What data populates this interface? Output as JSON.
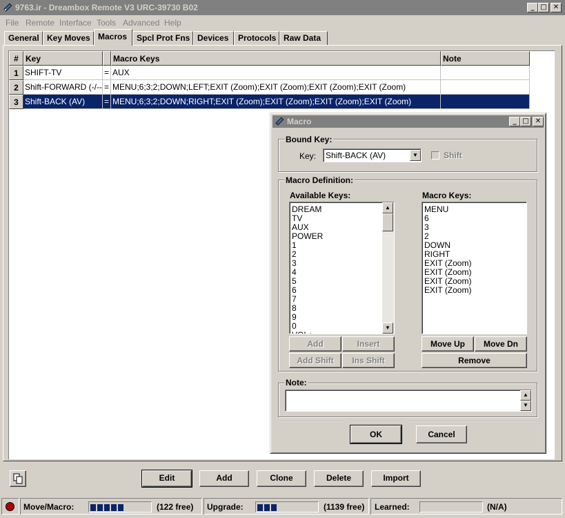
{
  "window": {
    "title": "9763.ir - Dreambox Remote V3 URC-39730 B02"
  },
  "menu": [
    "File",
    "Remote",
    "Interface",
    "Tools",
    "Advanced",
    "Help"
  ],
  "tabs": [
    "General",
    "Key Moves",
    "Macros",
    "Spcl Prot Fns",
    "Devices",
    "Protocols",
    "Raw Data"
  ],
  "active_tab": "Macros",
  "grid": {
    "headers": [
      "#",
      "Key",
      "",
      "Macro Keys",
      "Note"
    ],
    "rows": [
      {
        "num": "1",
        "key": "SHIFT-TV",
        "eq": "=",
        "macro": "AUX",
        "note": ""
      },
      {
        "num": "2",
        "key": "Shift-FORWARD (-/--)",
        "eq": "=",
        "macro": "MENU;6;3;2;DOWN;LEFT;EXIT (Zoom);EXIT (Zoom);EXIT (Zoom);EXIT (Zoom)",
        "note": ""
      },
      {
        "num": "3",
        "key": "Shift-BACK (AV)",
        "eq": "=",
        "macro": "MENU;6;3;2;DOWN;RIGHT;EXIT (Zoom);EXIT (Zoom);EXIT (Zoom);EXIT (Zoom)",
        "note": ""
      }
    ]
  },
  "dialog": {
    "title": "Macro",
    "bound_key_group": "Bound Key:",
    "key_label": "Key:",
    "key_value": "Shift-BACK (AV)",
    "shift_label": "Shift",
    "definition_group": "Macro Definition:",
    "available_label": "Available Keys:",
    "available_keys": [
      "DREAM",
      "TV",
      "AUX",
      "POWER",
      "1",
      "2",
      "3",
      "4",
      "5",
      "6",
      "7",
      "8",
      "9",
      "0",
      "VOL+"
    ],
    "macro_label": "Macro Keys:",
    "macro_keys": [
      "MENU",
      "6",
      "3",
      "2",
      "DOWN",
      "RIGHT",
      "EXIT (Zoom)",
      "EXIT (Zoom)",
      "EXIT (Zoom)",
      "EXIT (Zoom)"
    ],
    "buttons": {
      "add": "Add",
      "insert": "Insert",
      "add_shift": "Add Shift",
      "ins_shift": "Ins Shift",
      "move_up": "Move Up",
      "move_dn": "Move Dn",
      "remove": "Remove",
      "ok": "OK",
      "cancel": "Cancel"
    },
    "note_label": "Note:",
    "note_value": ""
  },
  "bottom_buttons": {
    "edit": "Edit",
    "add": "Add",
    "clone": "Clone",
    "delete": "Delete",
    "import": "Import"
  },
  "status": {
    "move_macro_label": "Move/Macro:",
    "move_macro_free": "(122 free)",
    "move_macro_used_fraction": 0.55,
    "upgrade_label": "Upgrade:",
    "upgrade_free": "(1139 free)",
    "upgrade_used_fraction": 0.33,
    "learned_label": "Learned:",
    "learned_value": "(N/A)",
    "indicator_color": "#b00000"
  },
  "colors": {
    "selection": "#0a246a",
    "face": "#d4d0c8",
    "inactive_title": "#808080"
  }
}
